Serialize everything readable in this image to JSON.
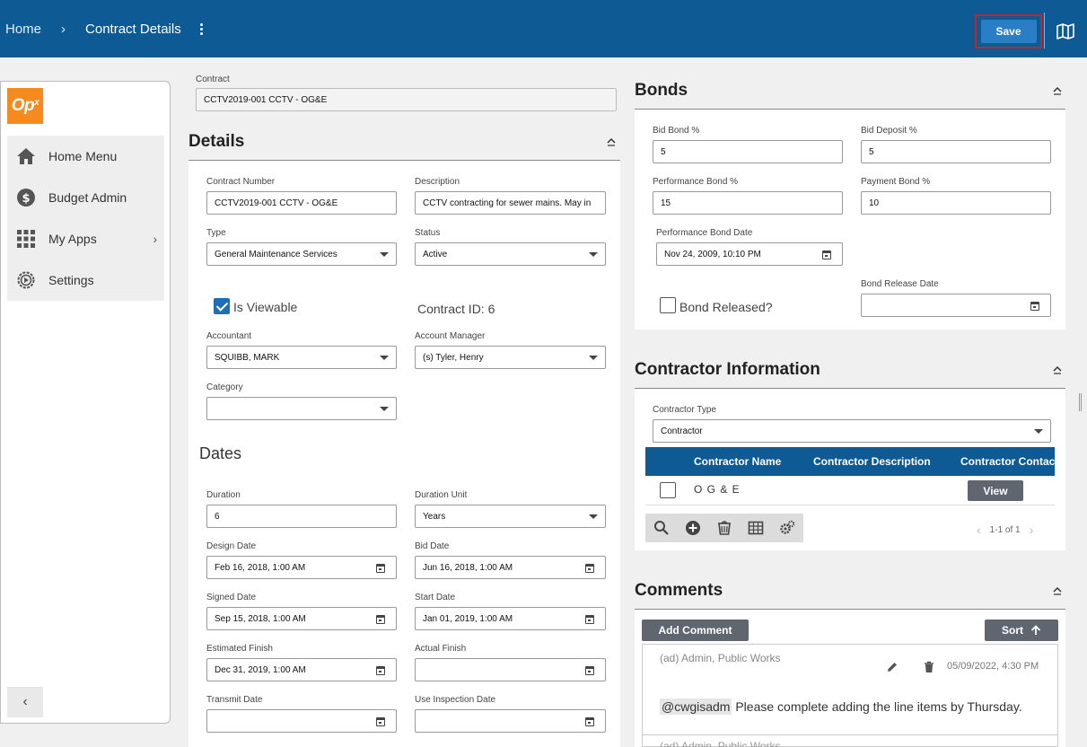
{
  "header": {
    "breadcrumb_home": "Home",
    "breadcrumb_sep": "›",
    "breadcrumb_current": "Contract Details",
    "save_label": "Save",
    "colors": {
      "bar": "#0e5a94",
      "save": "#2a7ec6",
      "save_outline": "#c0262e"
    }
  },
  "sidebar": {
    "logo_text": "Op",
    "logo_sup": "x",
    "items": [
      {
        "label": "Home Menu",
        "icon": "home-icon"
      },
      {
        "label": "Budget Admin",
        "icon": "dollar-circle-icon"
      },
      {
        "label": "My Apps",
        "icon": "grid-icon",
        "chevron": "›"
      },
      {
        "label": "Settings",
        "icon": "gear-icon"
      }
    ],
    "collapse_glyph": "‹"
  },
  "contract": {
    "label": "Contract",
    "value": "CCTV2019-001 CCTV - OG&E"
  },
  "details": {
    "title": "Details",
    "contract_number_label": "Contract Number",
    "contract_number": "CCTV2019-001 CCTV - OG&E",
    "description_label": "Description",
    "description": "CCTV contracting for sewer mains.  May in",
    "type_label": "Type",
    "type": "General Maintenance Services",
    "status_label": "Status",
    "status": "Active",
    "is_viewable_label": "Is Viewable",
    "is_viewable": true,
    "contract_id_text": "Contract ID: 6",
    "accountant_label": "Accountant",
    "accountant": "SQUIBB, MARK",
    "account_manager_label": "Account Manager",
    "account_manager": "(s) Tyler, Henry",
    "category_label": "Category",
    "category": ""
  },
  "dates": {
    "title": "Dates",
    "duration_label": "Duration",
    "duration": "6",
    "duration_unit_label": "Duration Unit",
    "duration_unit": "Years",
    "design_date_label": "Design Date",
    "design_date": "Feb 16, 2018, 1:00 AM",
    "bid_date_label": "Bid Date",
    "bid_date": "Jun 16, 2018, 1:00 AM",
    "signed_date_label": "Signed Date",
    "signed_date": "Sep 15, 2018, 1:00 AM",
    "start_date_label": "Start Date",
    "start_date": "Jan 01, 2019, 1:00 AM",
    "estimated_finish_label": "Estimated Finish",
    "estimated_finish": "Dec 31, 2019, 1:00 AM",
    "actual_finish_label": "Actual Finish",
    "actual_finish": "",
    "transmit_date_label": "Transmit Date",
    "transmit_date": "",
    "use_inspection_date_label": "Use Inspection Date",
    "use_inspection_date": ""
  },
  "bonds": {
    "title": "Bonds",
    "bid_bond_label": "Bid Bond %",
    "bid_bond": "5",
    "bid_deposit_label": "Bid Deposit %",
    "bid_deposit": "5",
    "performance_bond_label": "Performance Bond %",
    "performance_bond": "15",
    "payment_bond_label": "Payment Bond %",
    "payment_bond": "10",
    "performance_bond_date_label": "Performance Bond Date",
    "performance_bond_date": "Nov 24, 2009, 10:10 PM",
    "bond_released_label": "Bond Released?",
    "bond_released": false,
    "bond_release_date_label": "Bond Release Date",
    "bond_release_date": ""
  },
  "contractor": {
    "title": "Contractor Information",
    "type_label": "Contractor Type",
    "type": "Contractor",
    "columns": [
      "Contractor Name",
      "Contractor Description",
      "Contractor Contact"
    ],
    "rows": [
      {
        "name": "O G & E",
        "description": "",
        "action": "View"
      }
    ],
    "pager_text": "1-1 of 1",
    "pager_prev": "‹",
    "pager_next": "›"
  },
  "comments": {
    "title": "Comments",
    "add_label": "Add Comment",
    "sort_label": "Sort",
    "items": [
      {
        "author": "(ad) Admin, Public Works",
        "date": "05/09/2022, 4:30 PM",
        "mention": "@cwgisadm",
        "text": " Please complete adding the line items by Thursday."
      },
      {
        "author": "(ad) Admin, Public Works"
      }
    ]
  }
}
